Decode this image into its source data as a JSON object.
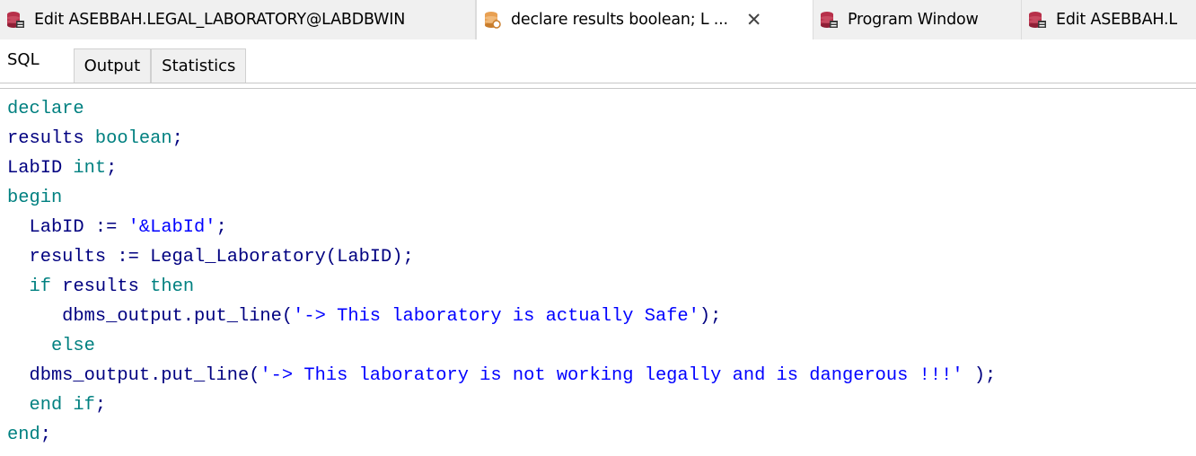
{
  "document_tabs": [
    {
      "label": "Edit ASEBBAH.LEGAL_LABORATORY@LABDBWIN",
      "icon": "database-edit-icon",
      "active": false
    },
    {
      "label": "declare results boolean; L ...",
      "icon": "sql-window-icon",
      "active": true,
      "close_symbol": "✕"
    },
    {
      "label": "Program Window",
      "icon": "database-edit-icon",
      "active": false
    },
    {
      "label": "Edit ASEBBAH.L",
      "icon": "database-edit-icon",
      "active": false
    }
  ],
  "sub_tabs": [
    {
      "label": "SQL",
      "active": true
    },
    {
      "label": "Output",
      "active": false
    },
    {
      "label": "Statistics",
      "active": false
    }
  ],
  "colors": {
    "keyword": "#008080",
    "identifier": "#000080",
    "string": "#0000ff",
    "tab_bar_bg": "#f0f0f0",
    "icon_red": "#b7304a",
    "icon_orange": "#e8a052"
  },
  "code": {
    "lines": [
      [
        {
          "t": "declare",
          "c": "kw"
        }
      ],
      [
        {
          "t": "results ",
          "c": "id"
        },
        {
          "t": "boolean",
          "c": "kw"
        },
        {
          "t": ";",
          "c": "id"
        }
      ],
      [
        {
          "t": "LabID ",
          "c": "id"
        },
        {
          "t": "int",
          "c": "kw"
        },
        {
          "t": ";",
          "c": "id"
        }
      ],
      [
        {
          "t": "begin",
          "c": "kw"
        }
      ],
      [
        {
          "t": "  LabID := ",
          "c": "id"
        },
        {
          "t": "'&LabId'",
          "c": "str"
        },
        {
          "t": ";",
          "c": "id"
        }
      ],
      [
        {
          "t": "  results := Legal_Laboratory(LabID);",
          "c": "id"
        }
      ],
      [
        {
          "t": "  ",
          "c": "id"
        },
        {
          "t": "if",
          "c": "kw"
        },
        {
          "t": " results ",
          "c": "id"
        },
        {
          "t": "then",
          "c": "kw"
        }
      ],
      [
        {
          "t": "     dbms_output.put_line(",
          "c": "id"
        },
        {
          "t": "'-> This laboratory is actually Safe'",
          "c": "str"
        },
        {
          "t": ");",
          "c": "id"
        }
      ],
      [
        {
          "t": "    ",
          "c": "id"
        },
        {
          "t": "else",
          "c": "kw"
        }
      ],
      [
        {
          "t": "  dbms_output.put_line(",
          "c": "id"
        },
        {
          "t": "'-> This laboratory is not working legally and is dangerous !!!'",
          "c": "str"
        },
        {
          "t": " );",
          "c": "id"
        }
      ],
      [
        {
          "t": "  ",
          "c": "id"
        },
        {
          "t": "end if",
          "c": "kw"
        },
        {
          "t": ";",
          "c": "id"
        }
      ],
      [
        {
          "t": "end",
          "c": "kw"
        },
        {
          "t": ";",
          "c": "id"
        }
      ]
    ]
  }
}
